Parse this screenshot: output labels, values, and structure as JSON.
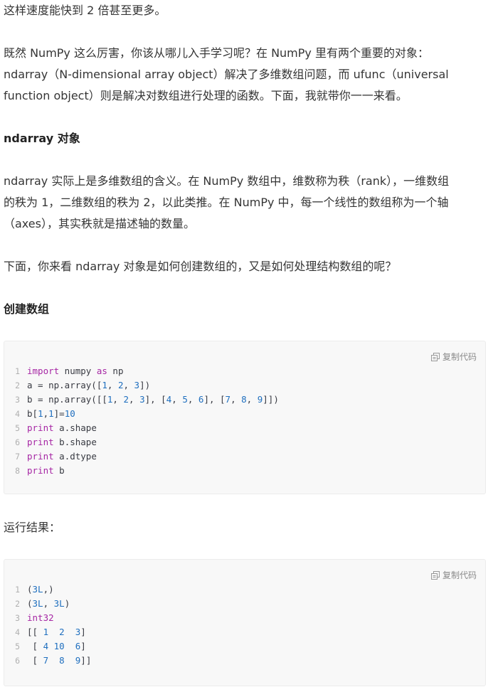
{
  "paragraphs": {
    "p0": "这样速度能快到 2 倍甚至更多。",
    "p1_l1": "既然 NumPy 这么厉害，你该从哪儿入手学习呢？在 NumPy 里有两个重要的对象：",
    "p1_l2": "ndarray（N-dimensional array object）解决了多维数组问题，而 ufunc（universal",
    "p1_l3": "function object）则是解决对数组进行处理的函数。下面，我就带你一一来看。",
    "h1": "ndarray 对象",
    "p2_l1": "ndarray 实际上是多维数组的含义。在 NumPy 数组中，维数称为秩（rank），一维数组",
    "p2_l2": "的秩为 1，二维数组的秩为 2，以此类推。在 NumPy 中，每一个线性的数组称为一个轴",
    "p2_l3": "（axes），其实秩就是描述轴的数量。",
    "p3": "下面，你来看 ndarray 对象是如何创建数组的，又是如何处理结构数组的呢？",
    "h2": "创建数组",
    "p4": "运行结果："
  },
  "copy_label": "复制代码",
  "code_block_1": {
    "line_numbers": [
      "1",
      "2",
      "3",
      "4",
      "5",
      "6",
      "7",
      "8"
    ],
    "lines": [
      [
        {
          "t": "kw",
          "v": "import"
        },
        {
          "t": "code",
          "v": " numpy "
        },
        {
          "t": "kw",
          "v": "as"
        },
        {
          "t": "code",
          "v": " np"
        }
      ],
      [
        {
          "t": "code",
          "v": "a = np.array(["
        },
        {
          "t": "num",
          "v": "1"
        },
        {
          "t": "code",
          "v": ", "
        },
        {
          "t": "num",
          "v": "2"
        },
        {
          "t": "code",
          "v": ", "
        },
        {
          "t": "num",
          "v": "3"
        },
        {
          "t": "code",
          "v": "])"
        }
      ],
      [
        {
          "t": "code",
          "v": "b = np.array([["
        },
        {
          "t": "num",
          "v": "1"
        },
        {
          "t": "code",
          "v": ", "
        },
        {
          "t": "num",
          "v": "2"
        },
        {
          "t": "code",
          "v": ", "
        },
        {
          "t": "num",
          "v": "3"
        },
        {
          "t": "code",
          "v": "], ["
        },
        {
          "t": "num",
          "v": "4"
        },
        {
          "t": "code",
          "v": ", "
        },
        {
          "t": "num",
          "v": "5"
        },
        {
          "t": "code",
          "v": ", "
        },
        {
          "t": "num",
          "v": "6"
        },
        {
          "t": "code",
          "v": "], ["
        },
        {
          "t": "num",
          "v": "7"
        },
        {
          "t": "code",
          "v": ", "
        },
        {
          "t": "num",
          "v": "8"
        },
        {
          "t": "code",
          "v": ", "
        },
        {
          "t": "num",
          "v": "9"
        },
        {
          "t": "code",
          "v": "]])"
        }
      ],
      [
        {
          "t": "code",
          "v": "b["
        },
        {
          "t": "num",
          "v": "1"
        },
        {
          "t": "code",
          "v": ","
        },
        {
          "t": "num",
          "v": "1"
        },
        {
          "t": "code",
          "v": "]="
        },
        {
          "t": "num",
          "v": "10"
        }
      ],
      [
        {
          "t": "kw",
          "v": "print"
        },
        {
          "t": "code",
          "v": " a.shape"
        }
      ],
      [
        {
          "t": "kw",
          "v": "print"
        },
        {
          "t": "code",
          "v": " b.shape"
        }
      ],
      [
        {
          "t": "kw",
          "v": "print"
        },
        {
          "t": "code",
          "v": " a.dtype"
        }
      ],
      [
        {
          "t": "kw",
          "v": "print"
        },
        {
          "t": "code",
          "v": " b"
        }
      ]
    ]
  },
  "code_block_2": {
    "line_numbers": [
      "1",
      "2",
      "3",
      "4",
      "5",
      "6"
    ],
    "lines": [
      [
        {
          "t": "code",
          "v": "("
        },
        {
          "t": "num",
          "v": "3L"
        },
        {
          "t": "code",
          "v": ",)"
        }
      ],
      [
        {
          "t": "code",
          "v": "("
        },
        {
          "t": "num",
          "v": "3L"
        },
        {
          "t": "code",
          "v": ", "
        },
        {
          "t": "num",
          "v": "3L"
        },
        {
          "t": "code",
          "v": ")"
        }
      ],
      [
        {
          "t": "kw",
          "v": "int32"
        }
      ],
      [
        {
          "t": "code",
          "v": "[[ "
        },
        {
          "t": "num",
          "v": "1"
        },
        {
          "t": "code",
          "v": "  "
        },
        {
          "t": "num",
          "v": "2"
        },
        {
          "t": "code",
          "v": "  "
        },
        {
          "t": "num",
          "v": "3"
        },
        {
          "t": "code",
          "v": "]"
        }
      ],
      [
        {
          "t": "code",
          "v": " [ "
        },
        {
          "t": "num",
          "v": "4"
        },
        {
          "t": "code",
          "v": " "
        },
        {
          "t": "num",
          "v": "10"
        },
        {
          "t": "code",
          "v": "  "
        },
        {
          "t": "num",
          "v": "6"
        },
        {
          "t": "code",
          "v": "]"
        }
      ],
      [
        {
          "t": "code",
          "v": " [ "
        },
        {
          "t": "num",
          "v": "7"
        },
        {
          "t": "code",
          "v": "  "
        },
        {
          "t": "num",
          "v": "8"
        },
        {
          "t": "code",
          "v": "  "
        },
        {
          "t": "num",
          "v": "9"
        },
        {
          "t": "code",
          "v": "]]"
        }
      ]
    ]
  }
}
